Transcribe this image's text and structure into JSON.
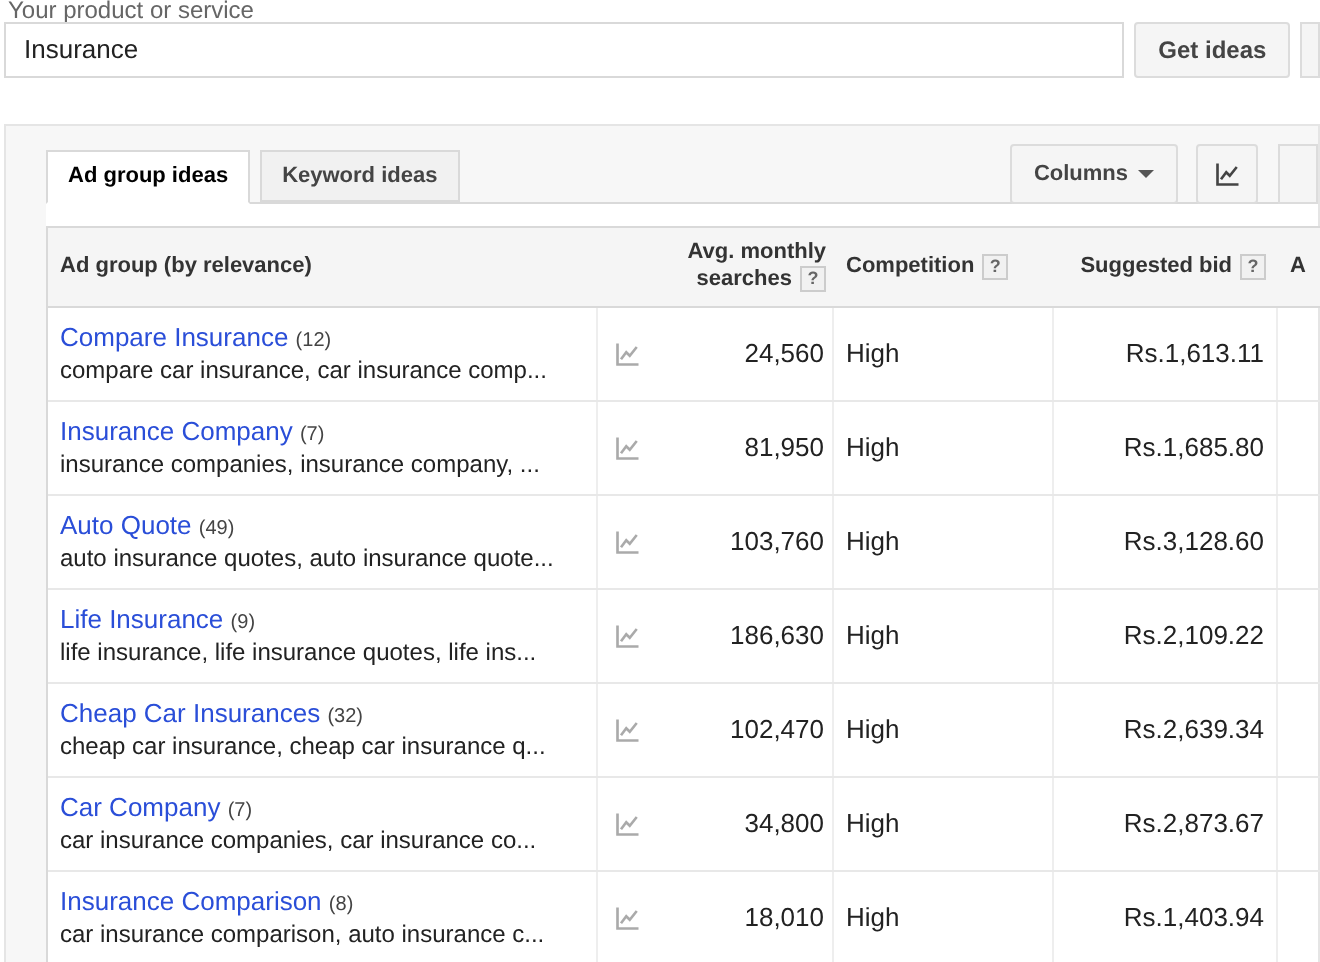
{
  "search": {
    "label": "Your product or service",
    "value": "Insurance",
    "button": "Get ideas"
  },
  "tabs": [
    {
      "label": "Ad group ideas",
      "selected": true
    },
    {
      "label": "Keyword ideas",
      "selected": false
    }
  ],
  "toolbar": {
    "columns_button": "Columns"
  },
  "table": {
    "columns": [
      {
        "label": "Ad group (by relevance)"
      },
      {
        "label": "Avg. monthly searches",
        "help": "?"
      },
      {
        "label": "Competition",
        "help": "?"
      },
      {
        "label": "Suggested bid",
        "help": "?"
      },
      {
        "label": "A"
      }
    ],
    "rows": [
      {
        "name": "Compare Insurance",
        "count": "(12)",
        "keywords": "compare car insurance, car insurance comp...",
        "searches": "24,560",
        "competition": "High",
        "bid": "Rs.1,613.11"
      },
      {
        "name": "Insurance Company",
        "count": "(7)",
        "keywords": "insurance companies, insurance company, ...",
        "searches": "81,950",
        "competition": "High",
        "bid": "Rs.1,685.80"
      },
      {
        "name": "Auto Quote",
        "count": "(49)",
        "keywords": "auto insurance quotes, auto insurance quote...",
        "searches": "103,760",
        "competition": "High",
        "bid": "Rs.3,128.60"
      },
      {
        "name": "Life Insurance",
        "count": "(9)",
        "keywords": "life insurance, life insurance quotes, life ins...",
        "searches": "186,630",
        "competition": "High",
        "bid": "Rs.2,109.22"
      },
      {
        "name": "Cheap Car Insurances",
        "count": "(32)",
        "keywords": "cheap car insurance, cheap car insurance q...",
        "searches": "102,470",
        "competition": "High",
        "bid": "Rs.2,639.34"
      },
      {
        "name": "Car Company",
        "count": "(7)",
        "keywords": "car insurance companies, car insurance co...",
        "searches": "34,800",
        "competition": "High",
        "bid": "Rs.2,873.67"
      },
      {
        "name": "Insurance Comparison",
        "count": "(8)",
        "keywords": "car insurance comparison, auto insurance c...",
        "searches": "18,010",
        "competition": "High",
        "bid": "Rs.1,403.94"
      }
    ]
  }
}
